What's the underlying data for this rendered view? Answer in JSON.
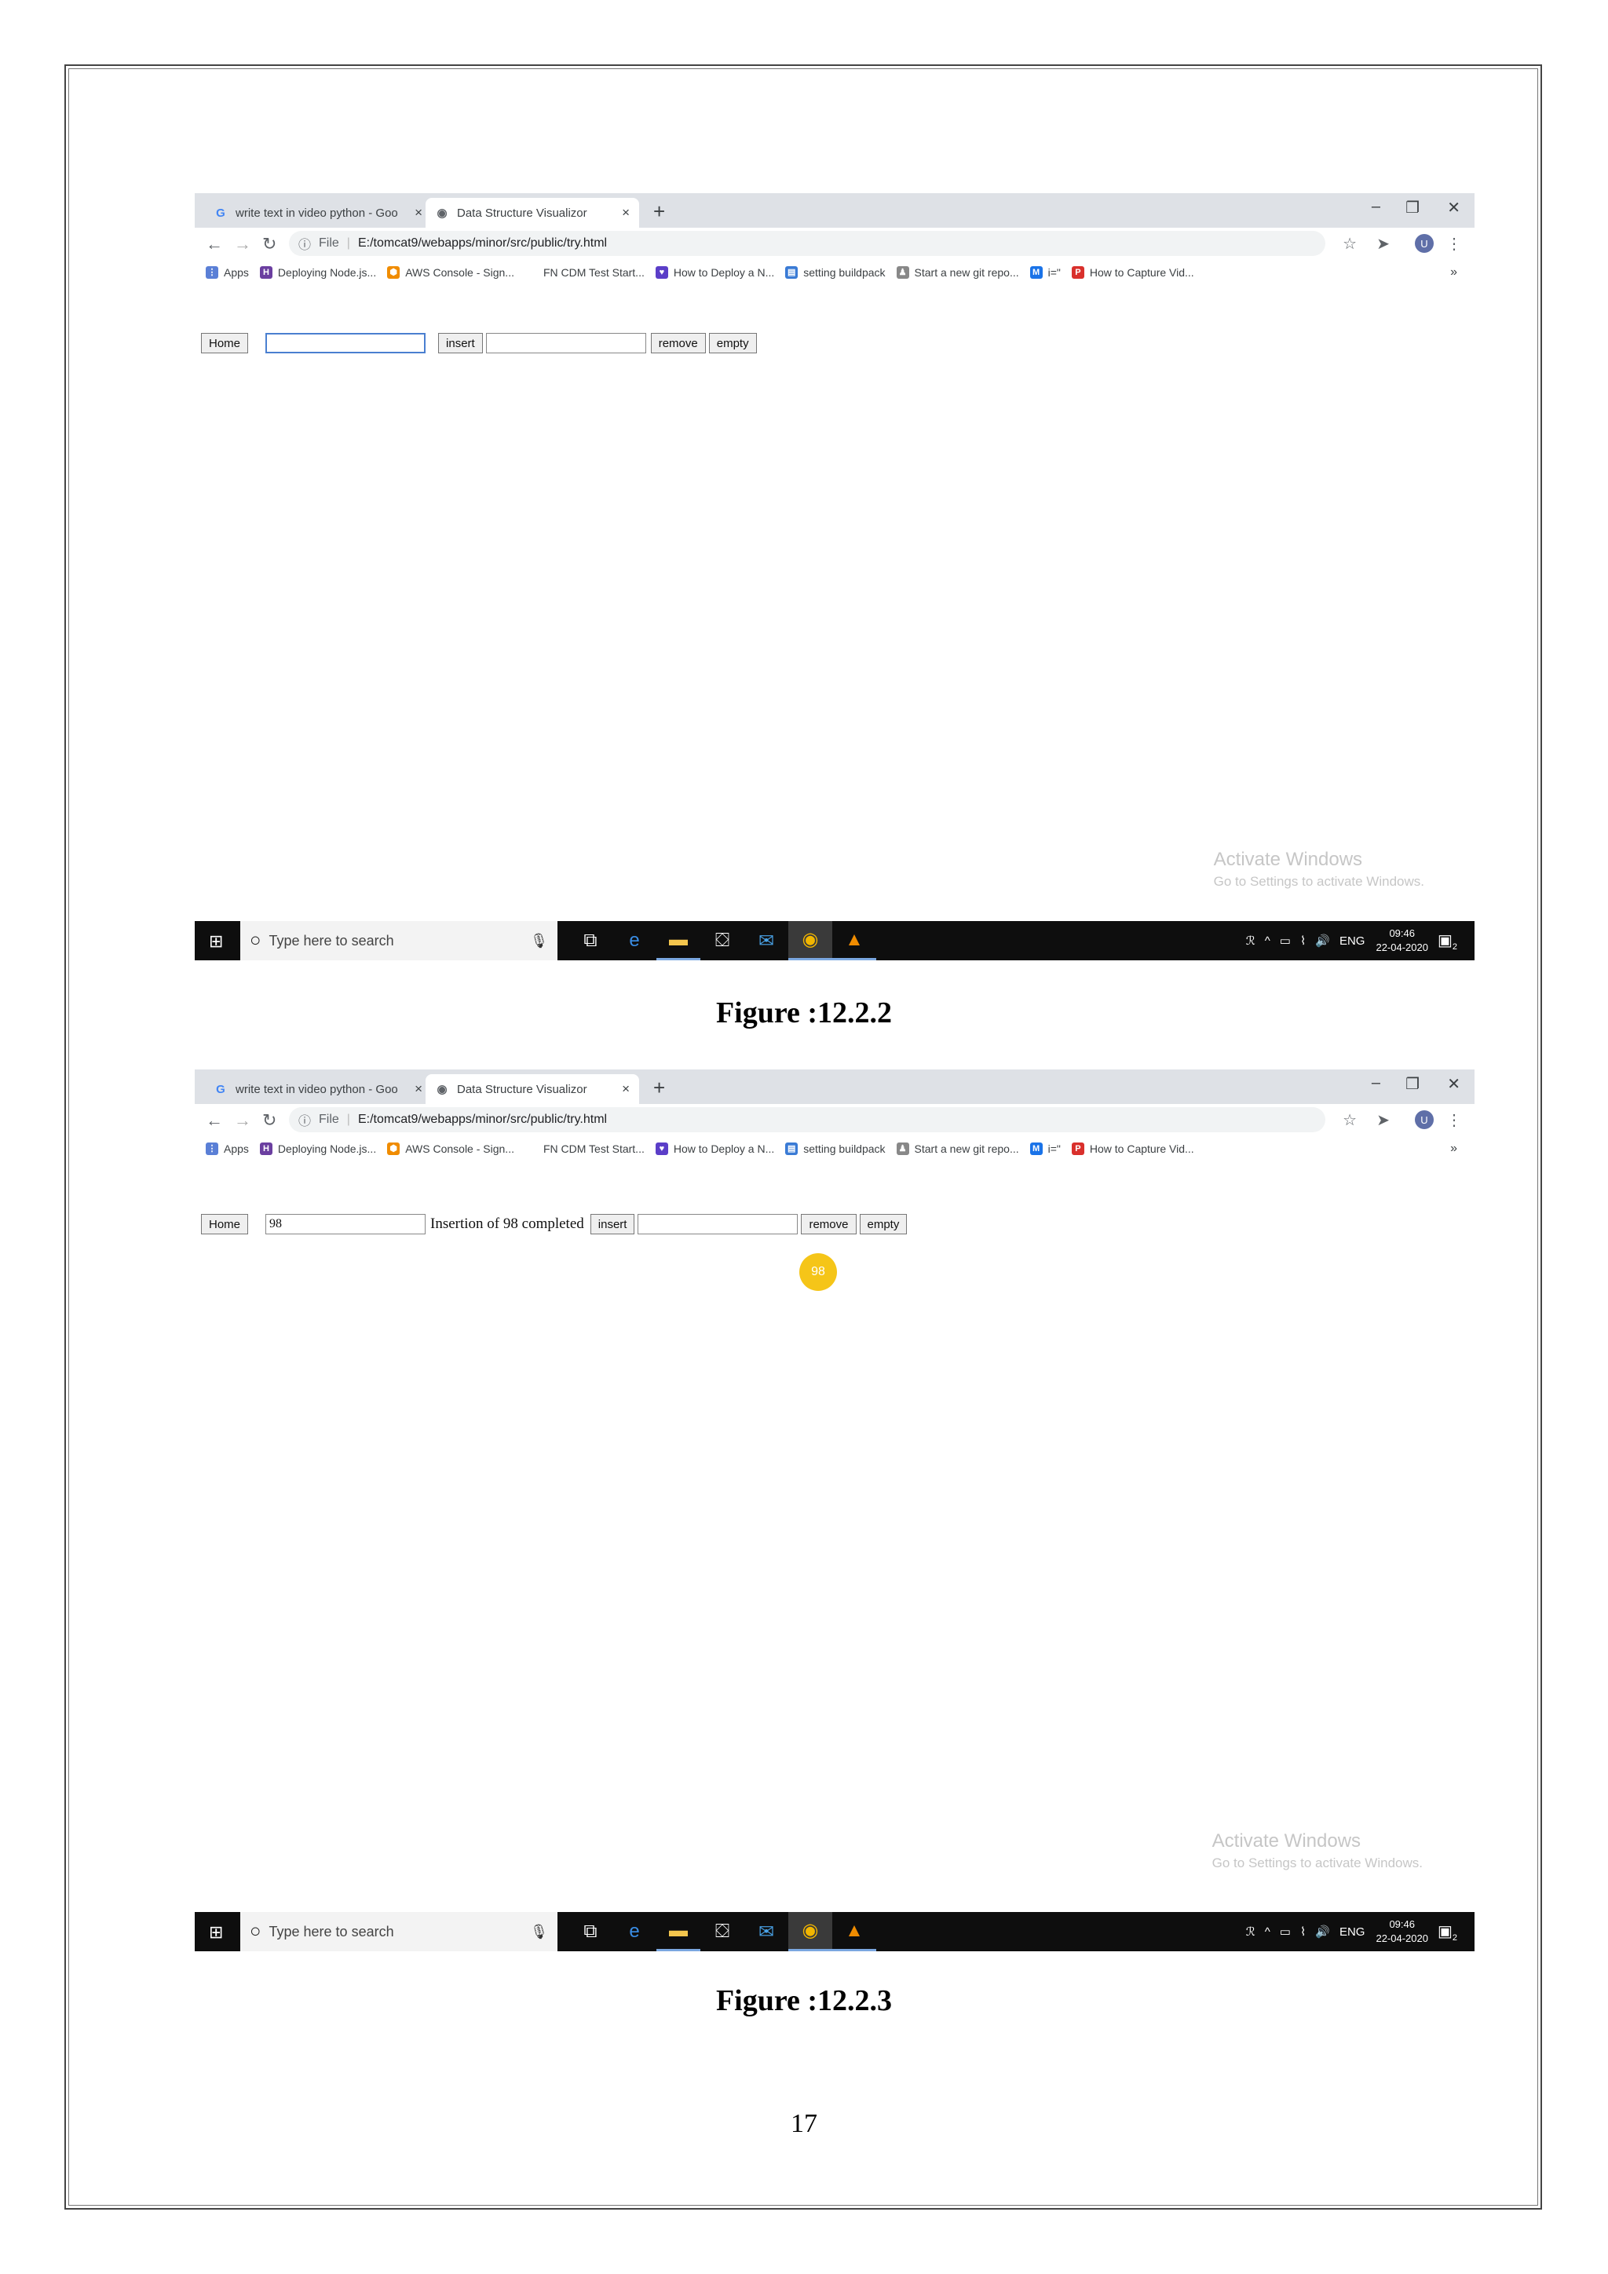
{
  "browser": {
    "tab_inactive_title": "write text in video python - Goo",
    "tab_active_title": "Data Structure Visualizor",
    "tab_close": "×",
    "new_tab": "+",
    "minimize": "–",
    "restore": "❐",
    "close": "✕",
    "file_label": "File",
    "url": "E:/tomcat9/webapps/minor/src/public/try.html",
    "avatar_letter": "U",
    "bookmarks": [
      {
        "label": "Apps",
        "color": "#5a7fd6"
      },
      {
        "label": "Deploying Node.js...",
        "color": "#6b3fa0"
      },
      {
        "label": "AWS Console - Sign...",
        "color": "#f08c00"
      },
      {
        "label": "FN CDM Test Start...",
        "color": "#ffffff"
      },
      {
        "label": "How to Deploy a N...",
        "color": "#5b3ec8"
      },
      {
        "label": "setting buildpack",
        "color": "#3a7bd5"
      },
      {
        "label": "Start a new git repo...",
        "color": "#888888"
      },
      {
        "label": "i=\"",
        "color": "#1a73e8"
      },
      {
        "label": "How to Capture Vid...",
        "color": "#d9302c"
      }
    ],
    "bookmarks_more": "»"
  },
  "app": {
    "home_label": "Home",
    "insert_label": "insert",
    "remove_label": "remove",
    "empty_label": "empty"
  },
  "figure1": {
    "input1_value": "",
    "input2_value": "",
    "caption": "Figure :12.2.2"
  },
  "figure2": {
    "input1_value": "98",
    "message": "Insertion of 98 completed",
    "input2_value": "",
    "node_value": "98",
    "caption": "Figure :12.2.3"
  },
  "watermark": {
    "line1": "Activate Windows",
    "line2": "Go to Settings to activate Windows."
  },
  "taskbar": {
    "search_placeholder": "Type here to search",
    "language": "ENG",
    "time": "09:46",
    "date": "22-04-2020",
    "notifications": "2"
  },
  "page_number": "17"
}
